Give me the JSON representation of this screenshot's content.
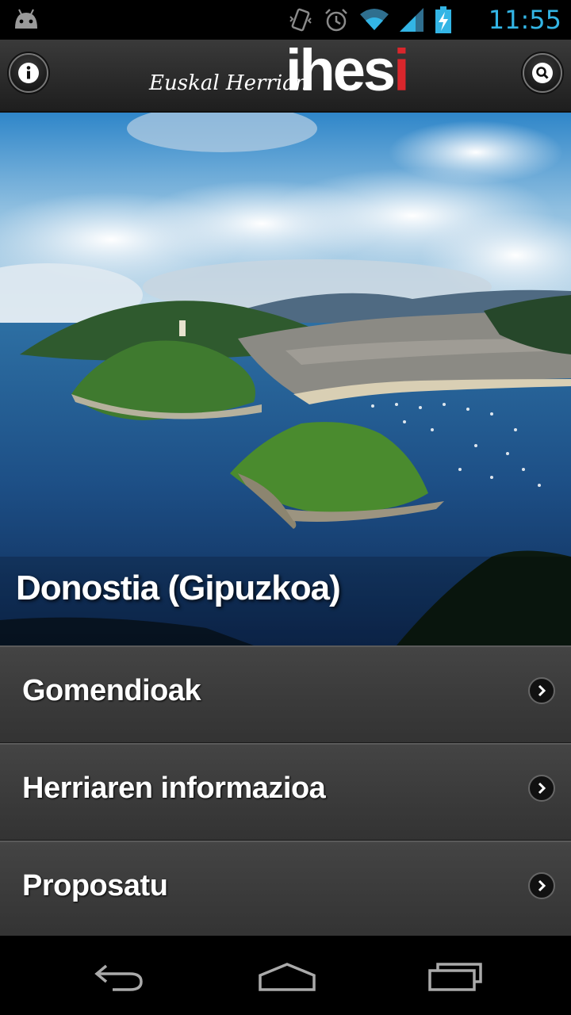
{
  "status_bar": {
    "time": "11:55",
    "icons": [
      "android-icon",
      "vibrate-icon",
      "alarm-icon",
      "wifi-icon",
      "signal-icon",
      "battery-charging-icon"
    ],
    "accent_color": "#33b5e5"
  },
  "header": {
    "logo_small": "Euskal Herrian",
    "logo_big_white": "ihes",
    "logo_big_red": "i",
    "brand_red": "#d9262c",
    "left_button_icon": "info-icon",
    "right_button_icon": "search-icon"
  },
  "hero": {
    "caption": "Donostia (Gipuzkoa)"
  },
  "menu": {
    "items": [
      {
        "label": "Gomendioak"
      },
      {
        "label": "Herriaren informazioa"
      },
      {
        "label": "Proposatu"
      }
    ]
  },
  "navbar": {
    "icons": [
      "back-icon",
      "home-icon",
      "recent-apps-icon"
    ]
  }
}
